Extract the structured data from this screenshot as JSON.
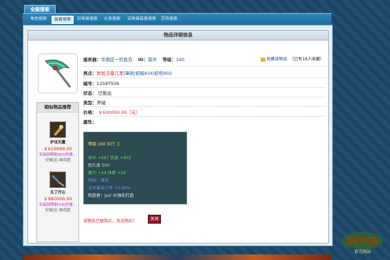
{
  "top_tab": "全服搜索",
  "nav": [
    {
      "label": "角色搜索",
      "active": false
    },
    {
      "label": "装备搜索",
      "active": true
    },
    {
      "label": "召唤兽搜索",
      "active": false
    },
    {
      "label": "元身搜索",
      "active": false
    },
    {
      "label": "召唤兽装备搜索",
      "active": false
    },
    {
      "label": "灵饰搜索",
      "active": false
    }
  ],
  "title": "物品详细信息",
  "similar": {
    "heading": "相似物品推荐",
    "items": [
      {
        "name": "护法灭魔",
        "price": "￥629999.00",
        "sub": "无级别限制|80|伤害…",
        "server": "安徽|区-雄鸡图"
      },
      {
        "name": "五丁开山",
        "price": "￥980000.00",
        "sub": "无级别限制|16|伤害…",
        "server": "安徽|区-雄鸡图"
      }
    ]
  },
  "info": {
    "server_label": "服务器：",
    "server_value": "华南区一钓鱼岛",
    "id_label": "ID：",
    "id_value": "裂天",
    "level_label": "等级：",
    "level_value": "160",
    "fav_label": "收藏该物品",
    "fav_count": "（已有18人收藏）",
    "highlight_label": "亮点：",
    "highlight_value": "附加法暴几率",
    "highlight_rest": "|锋锐|初级834|初伤602",
    "code_label": "编号：",
    "code_value": "1258T936",
    "status_label": "状态：",
    "status_value": "已售出",
    "type_label": "类型：",
    "type_value": "斧钺",
    "price_label": "价格：",
    "price_value": "￥630000.00（元）",
    "attr_label": "属性："
  },
  "stats": {
    "line1": "等级 160  五行 土",
    "line2": "命中 +697  伤害 +602",
    "line3": "耐久度 500",
    "line4": "魔力 +34  体质 +24",
    "line5": "特效：锋锐",
    "line6": "法术暴击几率 +0.94%",
    "line7": "制造者：Jurr の强化打造"
  },
  "note": "该物品已被购买，无法购买！",
  "close_label": "关闭",
  "logo_text": "梦幻西游",
  "logo_sub": "官方网站"
}
